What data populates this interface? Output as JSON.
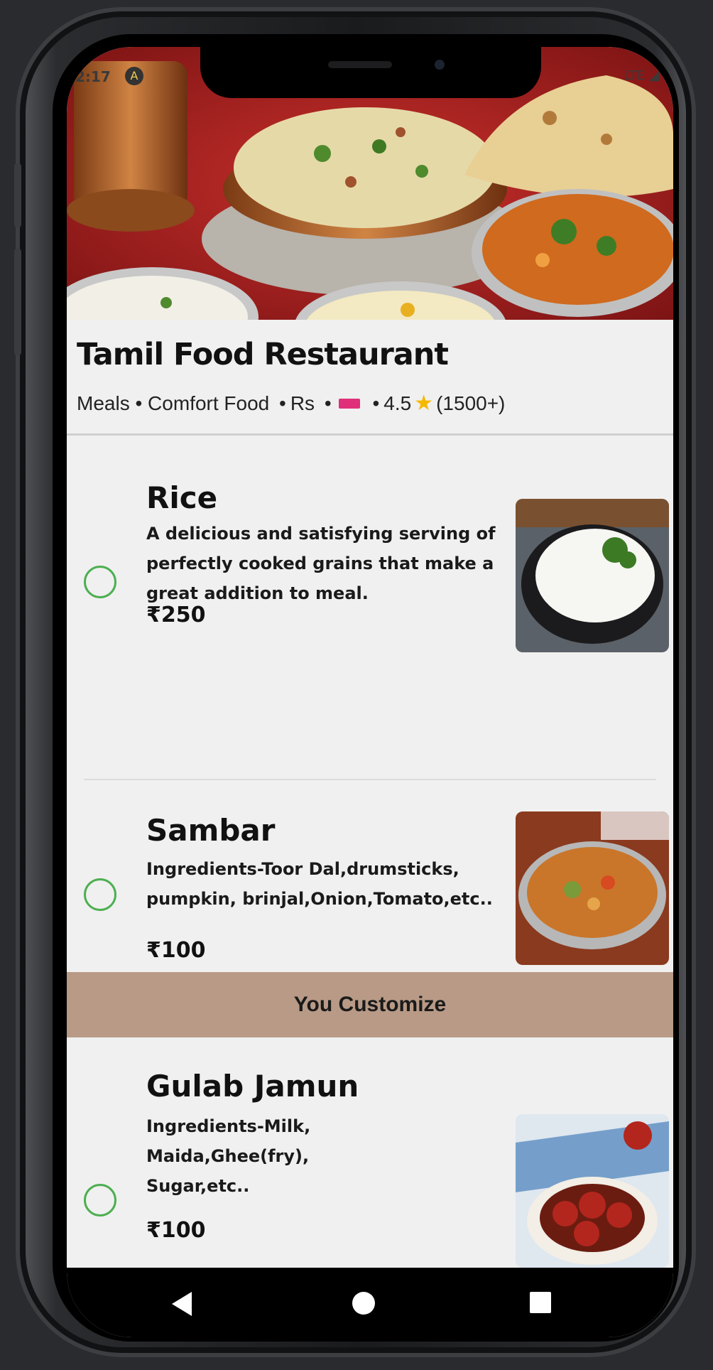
{
  "status_bar": {
    "time": "2:17",
    "network": "LTE"
  },
  "restaurant": {
    "name": "Tamil Food Restaurant",
    "categories": "Meals • Comfort Food",
    "price_label": "Rs",
    "rating": "4.5",
    "reviews": "(1500+)",
    "rating_icon": "star-icon",
    "price_icon": "ticket-icon"
  },
  "menu": {
    "items": [
      {
        "title": "Rice",
        "description": "A delicious and satisfying serving of perfectly cooked grains that make a great addition to meal.",
        "price": "₹250",
        "selected": false
      },
      {
        "title": "Sambar",
        "description": "Ingredients-Toor Dal,drumsticks, pumpkin, brinjal,Onion,Tomato,etc..",
        "price": "₹100",
        "selected": false
      },
      {
        "title": "Gulab Jamun",
        "description": "Ingredients-Milk, Maida,Ghee(fry), Sugar,etc..",
        "price": "₹100",
        "selected": false
      }
    ],
    "customize_label": "You Customize"
  },
  "colors": {
    "accent_green": "#4caf50",
    "customize_bar": "#b89a86"
  },
  "nav": {
    "back_icon": "back-triangle-icon",
    "home_icon": "home-circle-icon",
    "recents_icon": "recents-square-icon"
  }
}
